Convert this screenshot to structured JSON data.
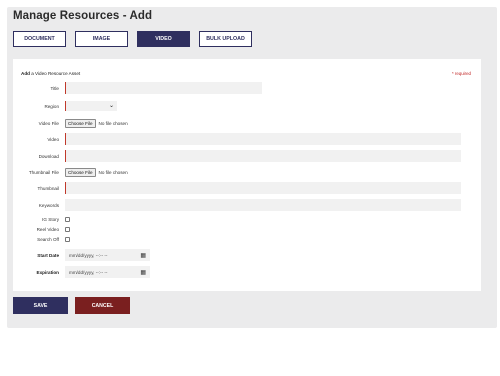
{
  "header": {
    "title": "Manage Resources - Add"
  },
  "tabs": [
    {
      "label": "DOCUMENT"
    },
    {
      "label": "IMAGE"
    },
    {
      "label": "VIDEO"
    },
    {
      "label": "BULK UPLOAD"
    }
  ],
  "form": {
    "heading_bold": "Add",
    "heading_rest": "a Video Resource Asset",
    "required_note": "* required",
    "fields": {
      "title": "Title",
      "region": "Region",
      "video_file": "Video File",
      "video": "Video",
      "download": "Download",
      "thumbnail_file": "Thumbnail File",
      "thumbnail": "Thumbnail",
      "keywords": "Keywords",
      "ig_story": "IG Story",
      "reel_video": "Reel Video",
      "search_off": "Search Off",
      "start_date": "Start Date",
      "expiration": "Expiration"
    },
    "file_button": "Choose File",
    "file_status": "No file chosen",
    "date_placeholder": "mm/dd/yyyy, --:-- --"
  },
  "actions": {
    "save": "SAVE",
    "cancel": "CANCEL"
  },
  "colors": {
    "primary": "#2f2f5f",
    "danger": "#7a1f1f",
    "required": "#c02424"
  }
}
